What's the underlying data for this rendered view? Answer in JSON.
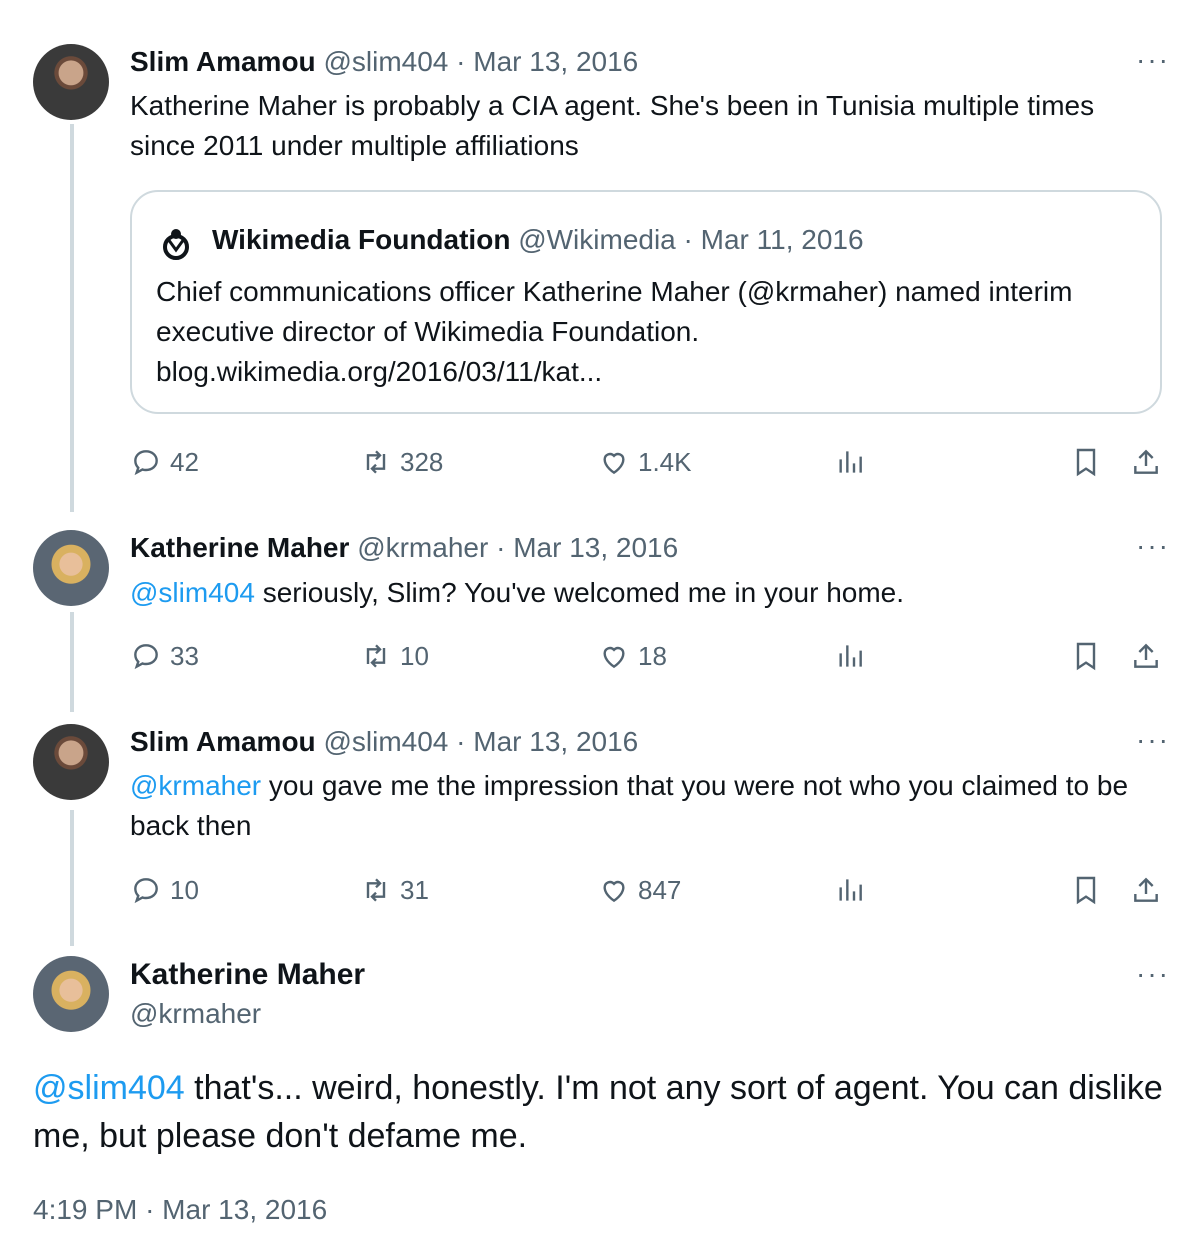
{
  "tweets": [
    {
      "name": "Slim Amamou",
      "handle": "@slim404",
      "date": "Mar 13, 2016",
      "text": "Katherine Maher is probably a CIA agent. She's been in Tunisia multiple times since 2011 under multiple affiliations",
      "quote": {
        "name": "Wikimedia Foundation",
        "handle": "@Wikimedia",
        "date": "Mar 11, 2016",
        "text": "Chief communications officer Katherine Maher (@krmaher) named interim executive director of Wikimedia Foundation. blog.wikimedia.org/2016/03/11/kat..."
      },
      "replies": "42",
      "reposts": "328",
      "likes": "1.4K"
    },
    {
      "name": "Katherine Maher",
      "handle": "@krmaher",
      "date": "Mar 13, 2016",
      "mention": "@slim404",
      "text": "seriously, Slim? You've welcomed me in your home.",
      "replies": "33",
      "reposts": "10",
      "likes": "18"
    },
    {
      "name": "Slim Amamou",
      "handle": "@slim404",
      "date": "Mar 13, 2016",
      "mention": "@krmaher",
      "text": "you gave me the impression that you were not who you claimed to be back then",
      "replies": "10",
      "reposts": "31",
      "likes": "847"
    }
  ],
  "main_tweet": {
    "name": "Katherine Maher",
    "handle": "@krmaher",
    "mention": "@slim404",
    "text": "that's... weird, honestly. I'm not any sort of agent. You can dislike me, but please don't defame me.",
    "time": "4:19 PM",
    "date": "Mar 13, 2016"
  },
  "ui": {
    "dot": "·",
    "more": "···"
  },
  "icons": [
    "reply-icon",
    "repost-icon",
    "like-icon",
    "views-icon",
    "bookmark-icon",
    "share-icon",
    "wikimedia-logo-icon"
  ]
}
